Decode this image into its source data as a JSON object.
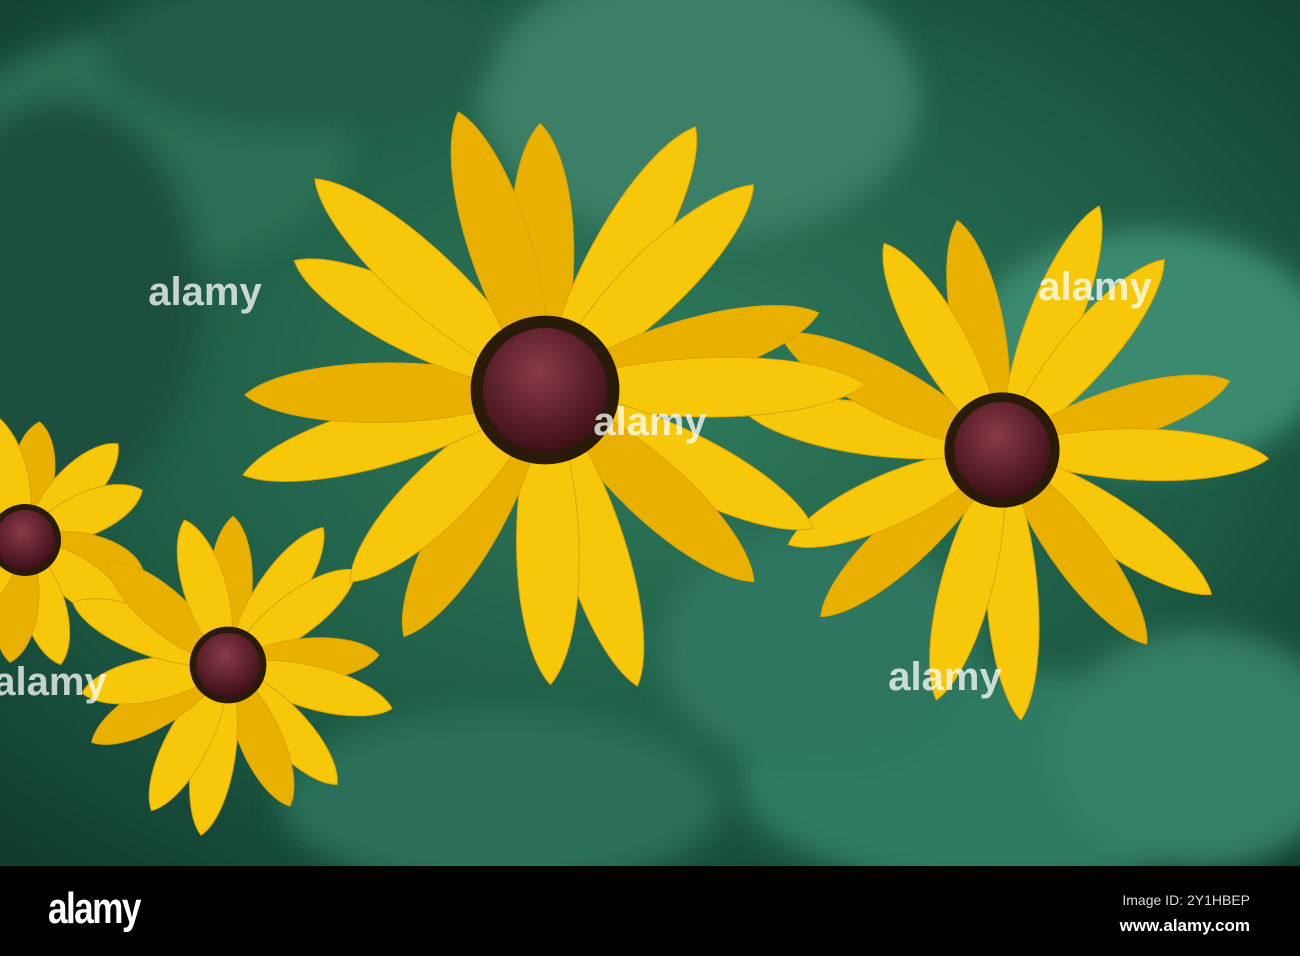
{
  "photo": {
    "subject": "three yellow flowers with dark centres",
    "colors": {
      "petal": "#f7c80a",
      "petal_shade": "#e6a800",
      "center": "#5a1f2a",
      "background": "#1f5a45"
    },
    "watermark": "alamy"
  },
  "footer": {
    "logo": "alamy",
    "image_id": "Image ID: 2Y1HBEP",
    "url": "www.alamy.com"
  }
}
